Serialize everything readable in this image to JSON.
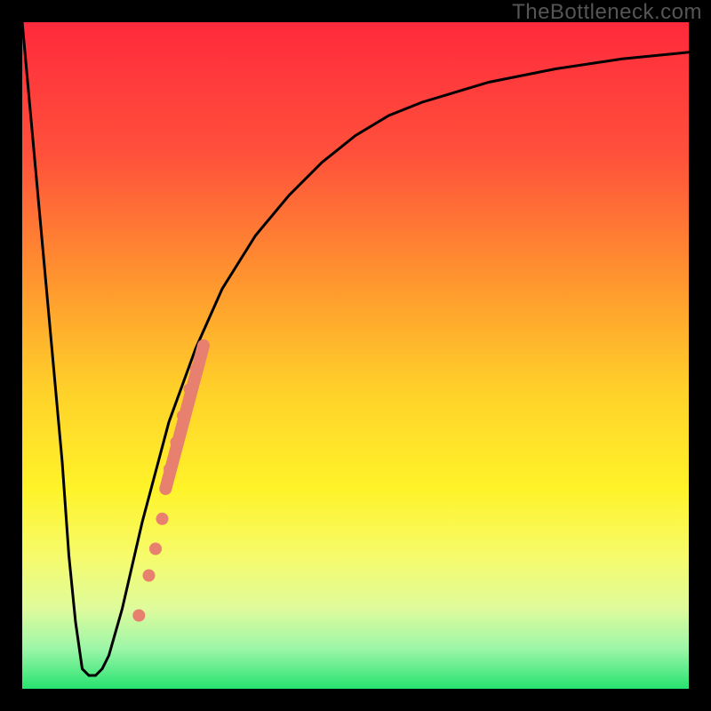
{
  "watermark": "TheBottleneck.com",
  "colors": {
    "frame": "#000000",
    "curve": "#000000",
    "dots": "#E7806F",
    "thickStroke": "#E7806F"
  },
  "chart_data": {
    "type": "line",
    "title": "",
    "xlabel": "",
    "ylabel": "",
    "xlim": [
      0,
      100
    ],
    "ylim": [
      0,
      100
    ],
    "grid": false,
    "note": "Background is a vertical gradient from red (top, high bottleneck) through orange/yellow to green (bottom, no bottleneck). The black curve starts at the top-left, drops sharply to ~0 near x≈9, stays low briefly, then rises asymptotically toward the top-right. A cluster of salmon-colored markers lies on the rising branch around x≈18–27, y≈10–50, with a thick salmon segment around x≈22–27.",
    "gradient_stops": [
      {
        "offset": 0.0,
        "color": "#FF2A3C"
      },
      {
        "offset": 0.2,
        "color": "#FF513B"
      },
      {
        "offset": 0.4,
        "color": "#FF9A2E"
      },
      {
        "offset": 0.55,
        "color": "#FFD02A"
      },
      {
        "offset": 0.7,
        "color": "#FFF329"
      },
      {
        "offset": 0.8,
        "color": "#F6FB6A"
      },
      {
        "offset": 0.88,
        "color": "#DFFB9C"
      },
      {
        "offset": 0.94,
        "color": "#9CF6A8"
      },
      {
        "offset": 1.0,
        "color": "#27E36F"
      }
    ],
    "series": [
      {
        "name": "bottleneck-curve",
        "x": [
          0,
          2,
          4,
          6,
          7,
          8,
          9,
          10,
          11,
          12,
          13,
          15,
          18,
          22,
          26,
          30,
          35,
          40,
          45,
          50,
          55,
          60,
          70,
          80,
          90,
          100
        ],
        "y": [
          100,
          78,
          56,
          34,
          20,
          10,
          3,
          2,
          2,
          3,
          5,
          12,
          25,
          40,
          51,
          60,
          68,
          74,
          79,
          83,
          86,
          88,
          91,
          93,
          94.5,
          95.5
        ]
      }
    ],
    "markers": {
      "name": "highlighted-points",
      "x": [
        17.5,
        19.0,
        20.0,
        21.0,
        22.0,
        23.0,
        24.0,
        25.0,
        26.0,
        27.0
      ],
      "y": [
        11.0,
        17.0,
        21.0,
        25.5,
        33.0,
        37.0,
        41.0,
        45.0,
        48.0,
        51.0
      ]
    },
    "thick_segment": {
      "x": [
        21.5,
        27.2
      ],
      "y": [
        30.0,
        51.5
      ]
    }
  }
}
